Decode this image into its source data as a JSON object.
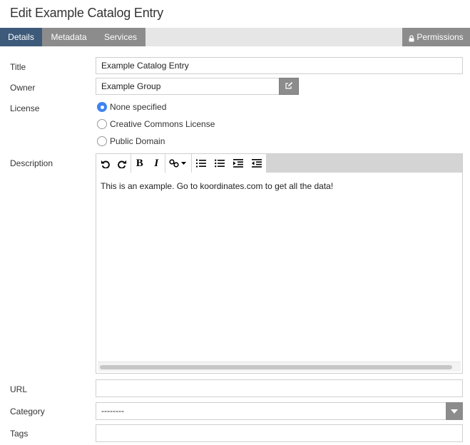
{
  "page": {
    "title": "Edit Example Catalog Entry"
  },
  "tabs": {
    "details": "Details",
    "metadata": "Metadata",
    "services": "Services",
    "permissions": "Permissions",
    "active": "Details"
  },
  "form": {
    "title": {
      "label": "Title",
      "value": "Example Catalog Entry"
    },
    "owner": {
      "label": "Owner",
      "value": "Example Group"
    },
    "license": {
      "label": "License",
      "options": [
        "None specified",
        "Creative Commons License",
        "Public Domain"
      ],
      "selected": "None specified"
    },
    "description": {
      "label": "Description",
      "value": "This is an example. Go to koordinates.com to get all the data!"
    },
    "url": {
      "label": "URL",
      "value": ""
    },
    "category": {
      "label": "Category",
      "value": "--------"
    },
    "tags": {
      "label": "Tags",
      "value": ""
    }
  },
  "colors": {
    "active_tab": "#3d5a7a",
    "inactive_tab": "#8c8c8c",
    "tabbar_bg": "#e6e6e6",
    "radio_selected": "#3f84f0"
  },
  "icons": {
    "permissions": "lock-icon",
    "owner_edit": "edit-icon",
    "toolbar": [
      "undo-icon",
      "redo-icon",
      "bold-icon",
      "italic-icon",
      "link-icon",
      "ordered-list-icon",
      "unordered-list-icon",
      "indent-icon",
      "outdent-icon"
    ],
    "category": "caret-down-icon"
  }
}
